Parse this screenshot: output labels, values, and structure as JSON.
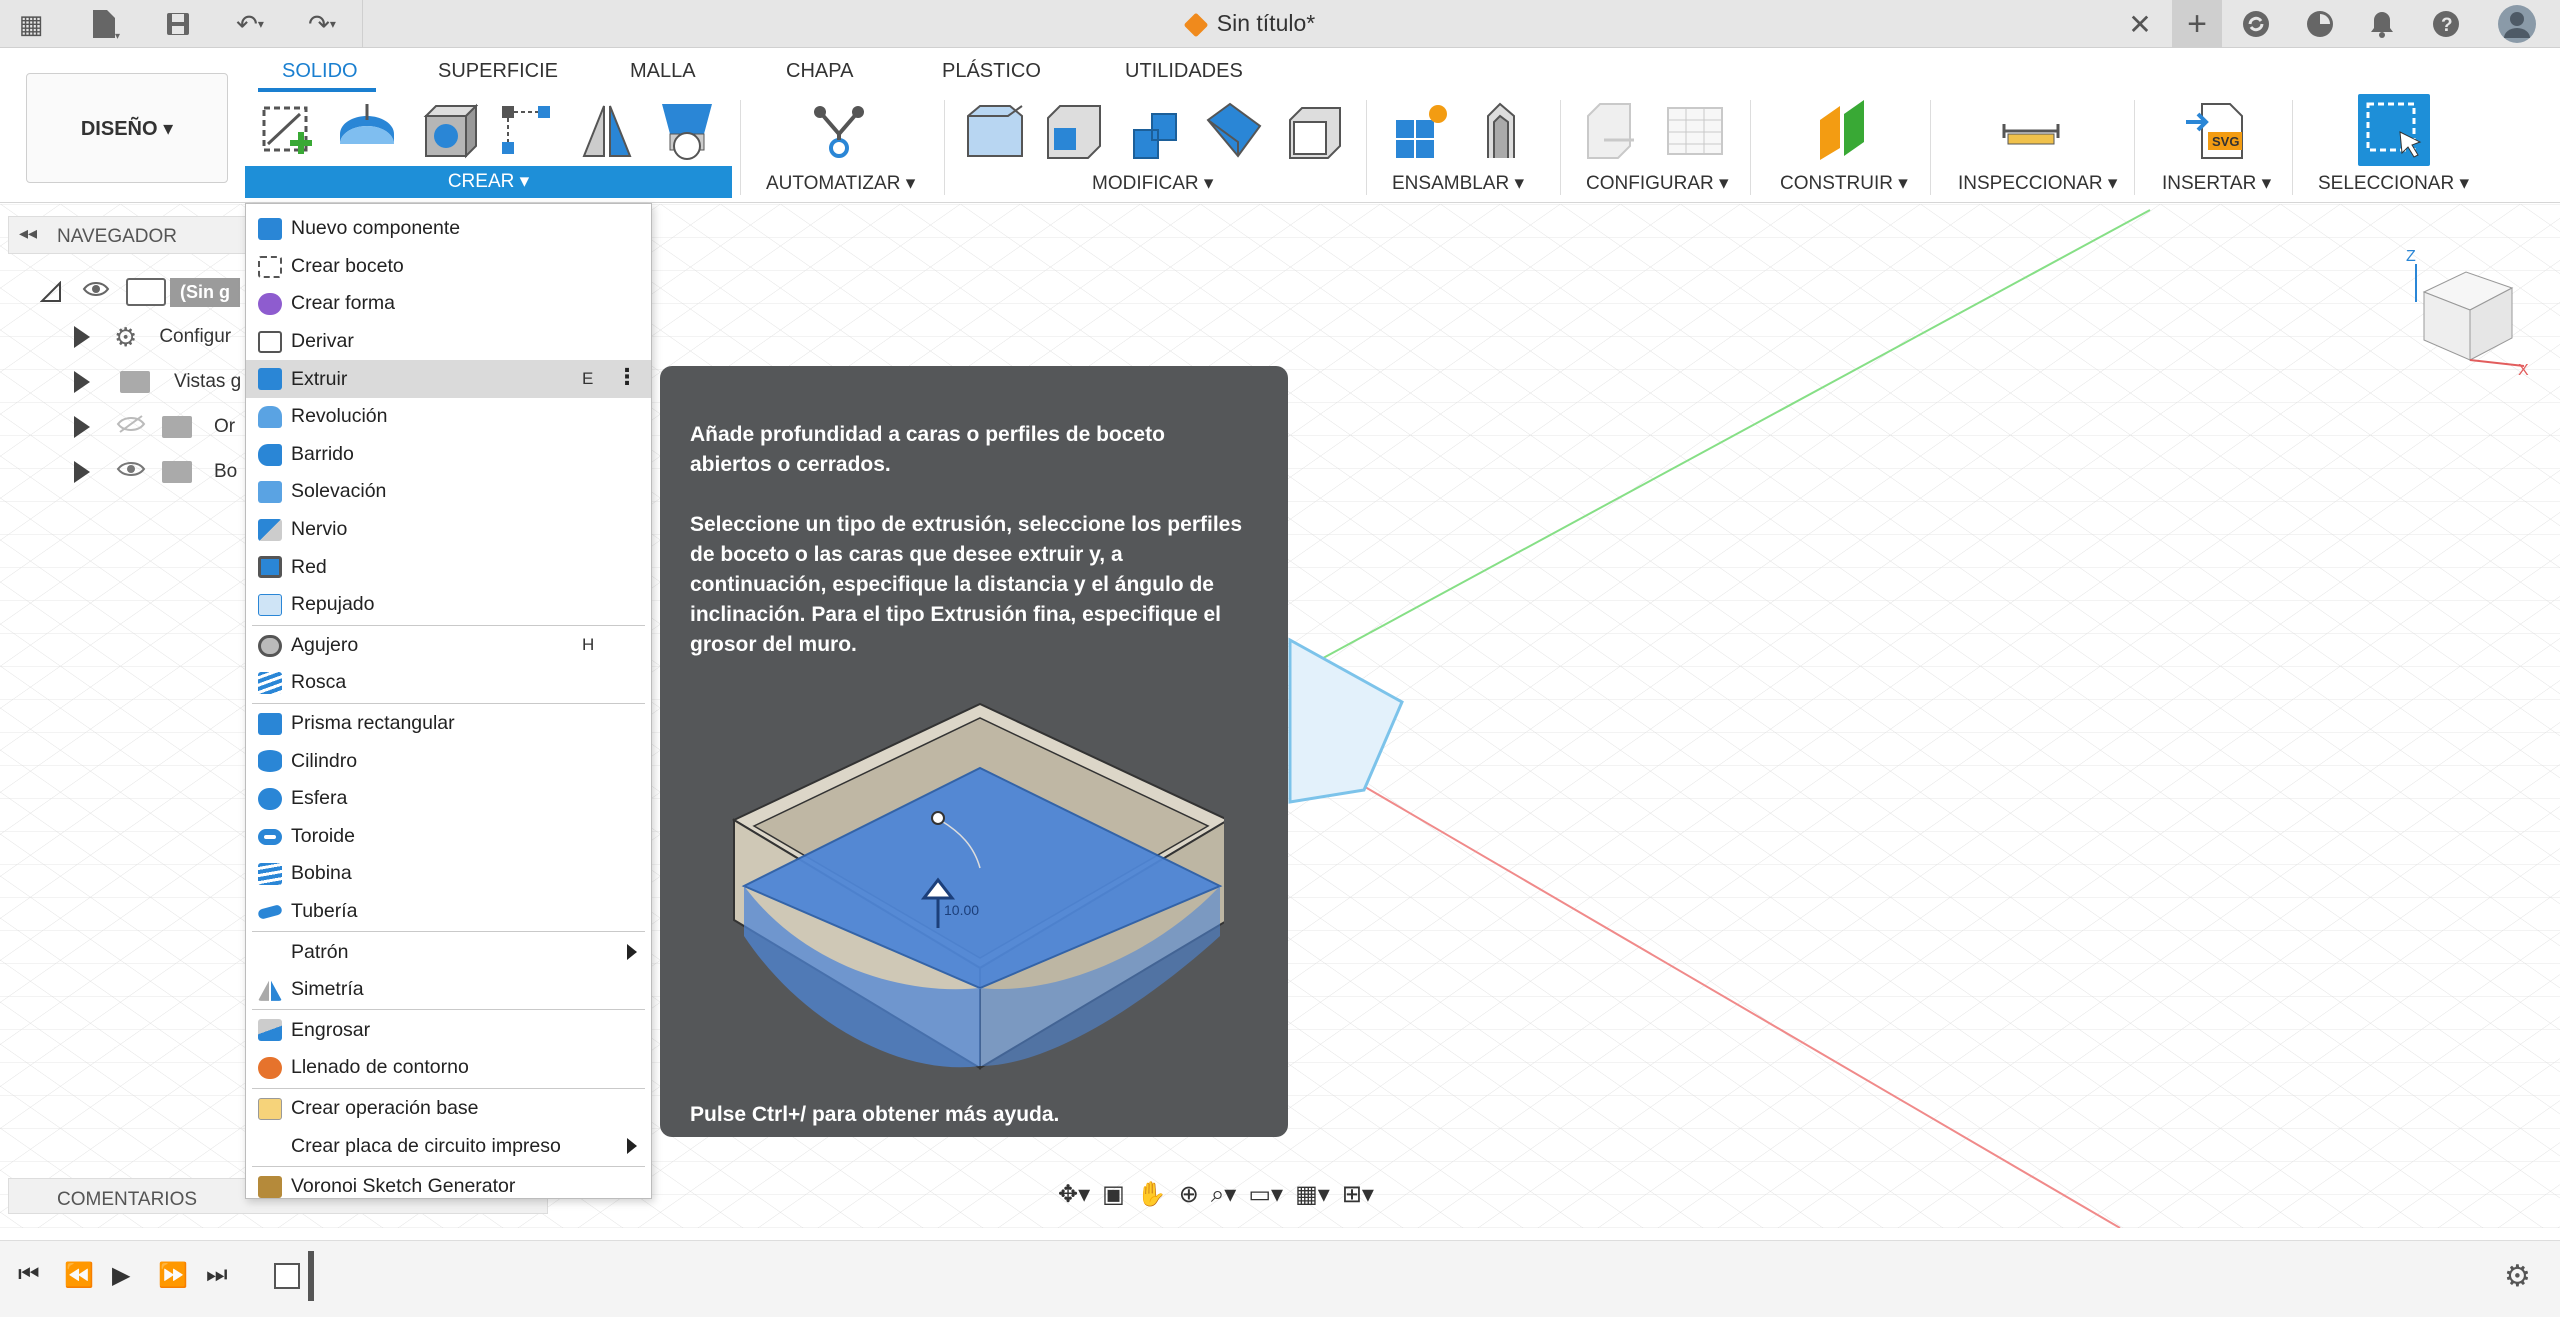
{
  "app": {
    "document_title": "Sin título*"
  },
  "toolbar": {
    "workspace_button": "DISEÑO ▾",
    "tabs": [
      "SOLIDO",
      "SUPERFICIE",
      "MALLA",
      "CHAPA",
      "PLÁSTICO",
      "UTILIDADES"
    ],
    "active_tab": "SOLIDO",
    "groups": {
      "crear": "CREAR ▾",
      "automatizar": "AUTOMATIZAR ▾",
      "modificar": "MODIFICAR ▾",
      "ensamblar": "ENSAMBLAR ▾",
      "configurar": "CONFIGURAR ▾",
      "construir": "CONSTRUIR ▾",
      "inspeccionar": "INSPECCIONAR ▾",
      "insertar": "INSERTAR ▾",
      "seleccionar": "SELECCIONAR ▾"
    },
    "accent_color": "#1e8fd8"
  },
  "browser": {
    "title": "NAVEGADOR",
    "root": "(Sin g",
    "items": [
      "Configur",
      "Vistas g",
      "Or",
      "Bo"
    ]
  },
  "comments": {
    "title": "COMENTARIOS"
  },
  "menu": {
    "items": [
      {
        "label": "Nuevo componente"
      },
      {
        "label": "Crear boceto"
      },
      {
        "label": "Crear forma"
      },
      {
        "label": "Derivar"
      },
      {
        "label": "Extruir",
        "shortcut": "E",
        "highlighted": true
      },
      {
        "label": "Revolución"
      },
      {
        "label": "Barrido"
      },
      {
        "label": "Solevación"
      },
      {
        "label": "Nervio"
      },
      {
        "label": "Red"
      },
      {
        "label": "Repujado"
      },
      {
        "label": "Agujero",
        "shortcut": "H"
      },
      {
        "label": "Rosca"
      },
      {
        "label": "Prisma rectangular"
      },
      {
        "label": "Cilindro"
      },
      {
        "label": "Esfera"
      },
      {
        "label": "Toroide"
      },
      {
        "label": "Bobina"
      },
      {
        "label": "Tubería"
      },
      {
        "label": "Patrón",
        "submenu": true
      },
      {
        "label": "Simetría"
      },
      {
        "label": "Engrosar"
      },
      {
        "label": "Llenado de contorno"
      },
      {
        "label": "Crear operación base"
      },
      {
        "label": "Crear placa de circuito impreso",
        "submenu": true
      },
      {
        "label": "Voronoi Sketch Generator"
      }
    ]
  },
  "tooltip": {
    "para1": "Añade profundidad a caras o perfiles de boceto abiertos o cerrados.",
    "para2": "Seleccione un tipo de extrusión, seleccione los perfiles de boceto o las caras que desee extruir y, a continuación, especifique la distancia y el ángulo de inclinación. Para el tipo Extrusión fina, especifique el grosor del muro.",
    "dimension": "10.00",
    "help": "Pulse Ctrl+/ para obtener más ayuda."
  },
  "viewcube": {
    "axis_z": "Z",
    "axis_x": "X"
  }
}
